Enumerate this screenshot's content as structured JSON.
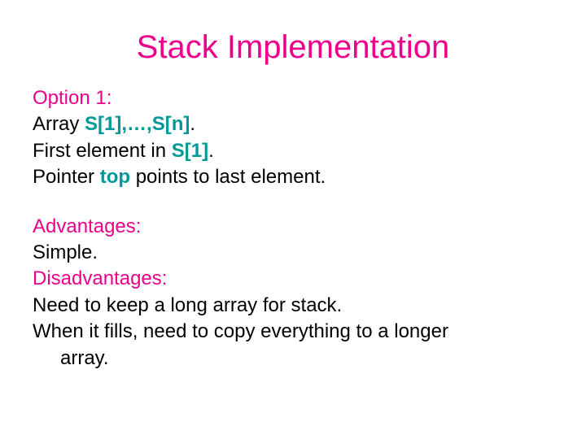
{
  "title": "Stack Implementation",
  "option_label": "Option 1:",
  "array_word": "Array ",
  "array_expr": "S[1],…,S[n]",
  "array_period": ".",
  "first_text1": "First element in ",
  "first_s1": "S[1]",
  "first_period": ".",
  "pointer_text1": "Pointer ",
  "pointer_top": "top",
  "pointer_text2": " points to last element.",
  "adv_label": "Advantages:",
  "adv_text": "Simple.",
  "dis_label": "Disadvantages:",
  "dis_text1": "Need to keep a long array for stack.",
  "dis_text2a": "When it fills, need to copy everything to a longer",
  "dis_text2b": "array."
}
